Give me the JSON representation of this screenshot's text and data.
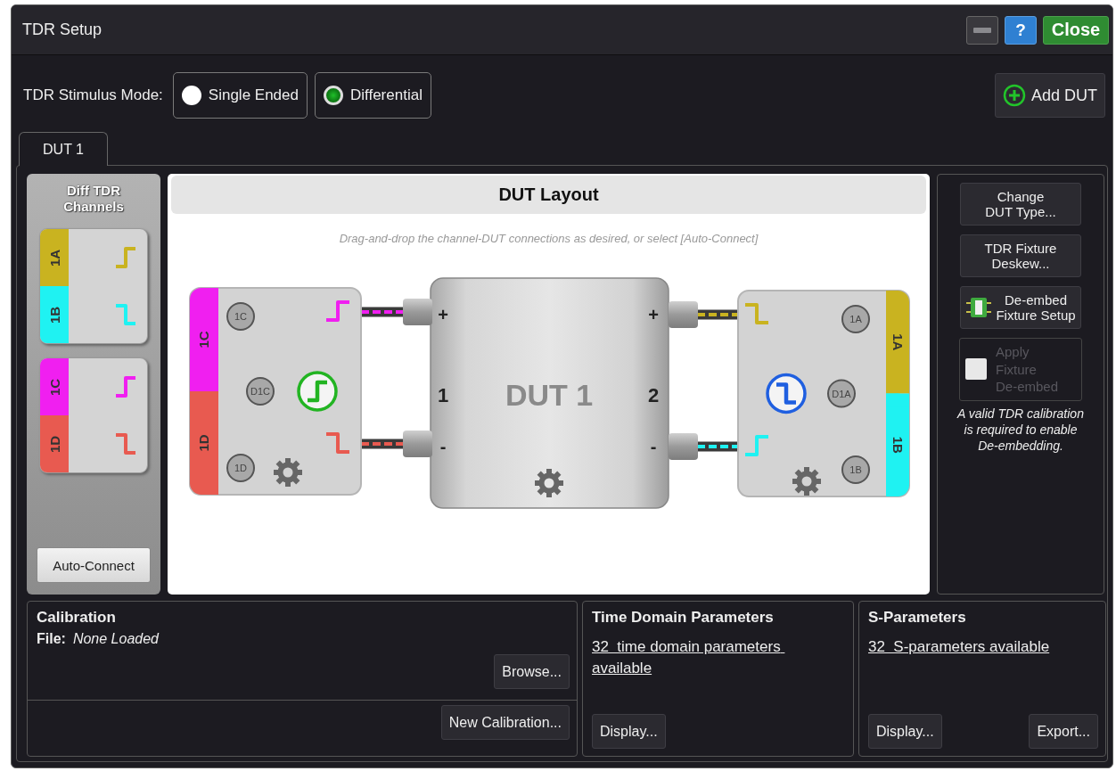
{
  "window": {
    "title": "TDR Setup",
    "buttons": [
      {
        "kind": "minimize"
      },
      {
        "kind": "help",
        "label": "?"
      },
      {
        "kind": "close",
        "label": "Close"
      }
    ]
  },
  "stimulus_mode": {
    "label": "TDR Stimulus Mode:",
    "options": [
      {
        "label": "Single Ended",
        "selected": false
      },
      {
        "label": "Differential",
        "selected": true
      }
    ]
  },
  "add_dut": {
    "label": "Add DUT"
  },
  "tabs": [
    {
      "label": "DUT 1",
      "selected": true
    }
  ],
  "channels_panel": {
    "title": "Diff TDR Channels",
    "groups": [
      {
        "channels": [
          {
            "label": "1A",
            "color": "#c9b320",
            "kind": "rising"
          },
          {
            "label": "1B",
            "color": "#1ff2f2",
            "kind": "falling"
          }
        ]
      },
      {
        "channels": [
          {
            "label": "1C",
            "color": "#f01ff0",
            "kind": "rising"
          },
          {
            "label": "1D",
            "color": "#e85a50",
            "kind": "falling"
          }
        ]
      }
    ],
    "auto_connect": "Auto-Connect"
  },
  "dut_layout": {
    "title": "DUT Layout",
    "hint": "Drag-and-drop the channel-DUT connections as desired, or select [Auto-Connect]",
    "dut": {
      "label": "DUT 1",
      "ports": [
        {
          "number": "1",
          "plus": "+",
          "minus": "-"
        },
        {
          "number": "2",
          "plus": "+",
          "minus": "-"
        }
      ]
    },
    "modules": [
      {
        "kind": "left",
        "diff_badge": "D1C",
        "stimulus": {
          "kind": "rising",
          "color": "#22b422"
        },
        "channels": [
          {
            "label": "1C",
            "badge": "1C",
            "color": "#f01ff0",
            "kind": "rising"
          },
          {
            "label": "1D",
            "badge": "1D",
            "color": "#e85a50",
            "kind": "falling"
          }
        ]
      },
      {
        "kind": "right",
        "diff_badge": "D1A",
        "stimulus": {
          "kind": "falling",
          "color": "#1f5fe0"
        },
        "channels": [
          {
            "label": "1A",
            "badge": "1A",
            "color": "#c9b320",
            "kind": "falling"
          },
          {
            "label": "1B",
            "badge": "1B",
            "color": "#1ff2f2",
            "kind": "rising"
          }
        ]
      }
    ]
  },
  "side_panel": {
    "buttons": [
      {
        "kind": "text",
        "label": "Change\nDUT Type..."
      },
      {
        "kind": "text",
        "label": "TDR Fixture\nDeskew..."
      },
      {
        "kind": "chip",
        "label": "De-embed\nFixture Setup"
      }
    ],
    "apply_fixture": {
      "label": "Apply\nFixture\nDe-embed",
      "checked": false,
      "disabled": true
    },
    "note": "A valid TDR calibration\nis required to enable\nDe-embedding."
  },
  "calibration": {
    "title": "Calibration",
    "file_label": "File:",
    "file_value": "None Loaded",
    "buttons": [
      {
        "label": "Browse..."
      },
      {
        "label": "New Calibration..."
      }
    ]
  },
  "time_domain": {
    "title": "Time Domain Parameters",
    "link": "32  time domain parameters available",
    "buttons": [
      {
        "label": "Display..."
      }
    ]
  },
  "s_parameters": {
    "title": "S-Parameters",
    "link": "32  S-parameters available",
    "buttons": [
      {
        "label": "Display..."
      },
      {
        "label": "Export..."
      }
    ]
  }
}
